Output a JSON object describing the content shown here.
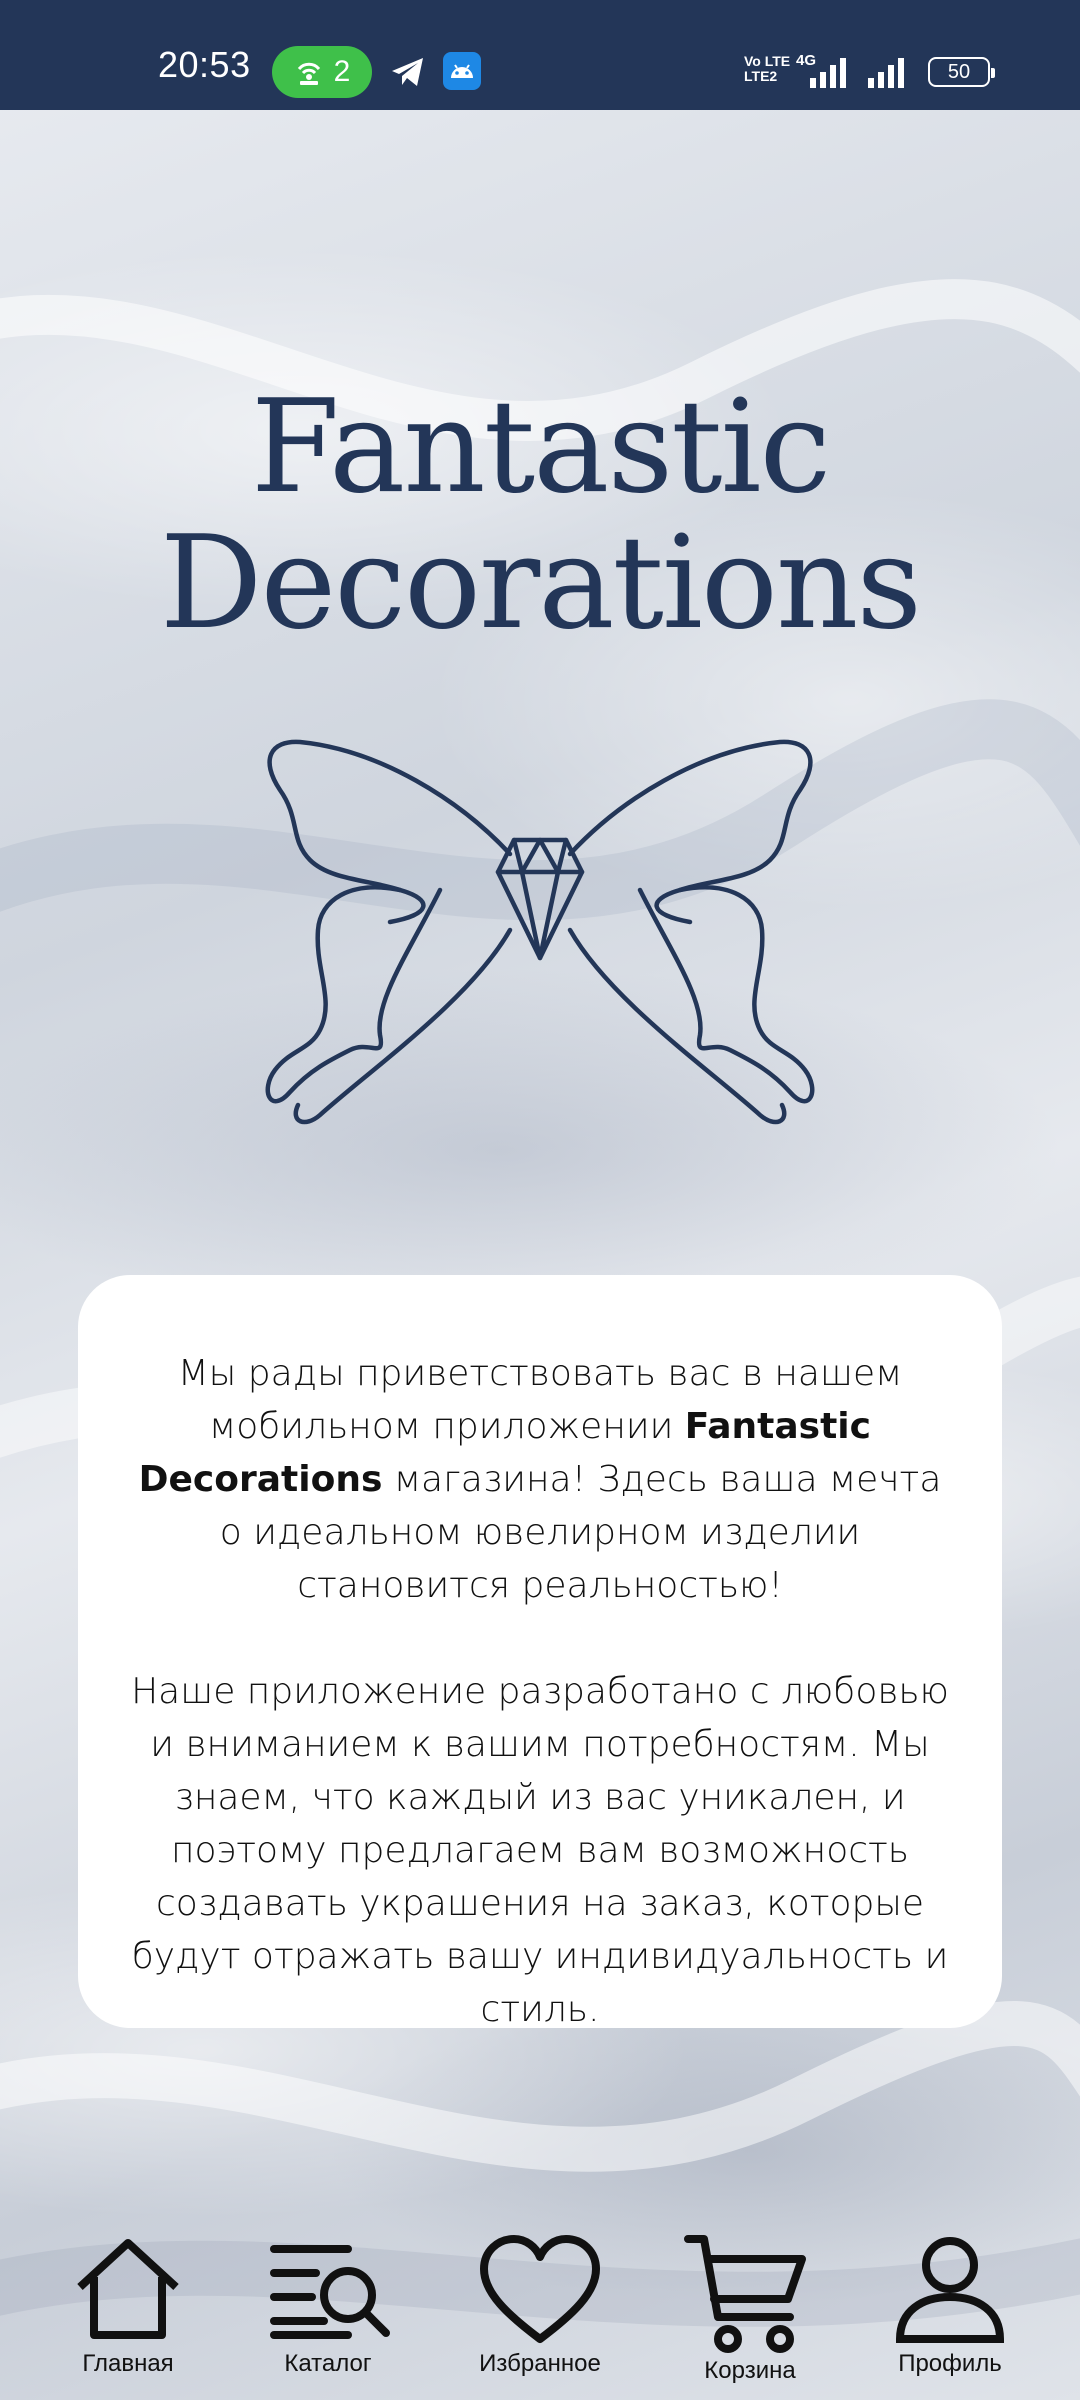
{
  "status_bar": {
    "time": "20:53",
    "hotspot_count": "2",
    "network_label_top": "Vo LTE",
    "network_label_bottom": "LTE2",
    "network_type": "4G",
    "battery": "50",
    "icons": [
      "hotspot-icon",
      "telegram-icon",
      "android-icon",
      "signal-icon",
      "signal-icon",
      "battery-icon"
    ]
  },
  "brand": {
    "line1": "Fantastic",
    "line2": "Decorations",
    "logo": "butterfly-diamond-logo",
    "color": "#233658"
  },
  "welcome": {
    "p1_before": "Мы рады приветствовать вас в нашем мобильном приложении ",
    "p1_brand": "Fantastic Decorations",
    "p1_after": " магазина! Здесь ваша мечта о идеальном ювелирном изделии становится реальностью!",
    "p2": "Наше приложение разработано с любовью и вниманием к вашим потребностям. Мы знаем, что каждый из вас уникален, и поэтому предлагаем вам возможность создавать украшения на заказ, которые будут отражать вашу индивидуальность и стиль."
  },
  "nav": {
    "items": [
      {
        "label": "Главная",
        "icon": "home-icon"
      },
      {
        "label": "Каталог",
        "icon": "catalog-search-icon"
      },
      {
        "label": "Избранное",
        "icon": "heart-icon"
      },
      {
        "label": "Корзина",
        "icon": "cart-icon"
      },
      {
        "label": "Профиль",
        "icon": "profile-icon"
      }
    ]
  },
  "colors": {
    "status_bar": "#233658",
    "hotspot_badge": "#3fc04a",
    "android_badge": "#1e88e5",
    "card": "#ffffff"
  }
}
